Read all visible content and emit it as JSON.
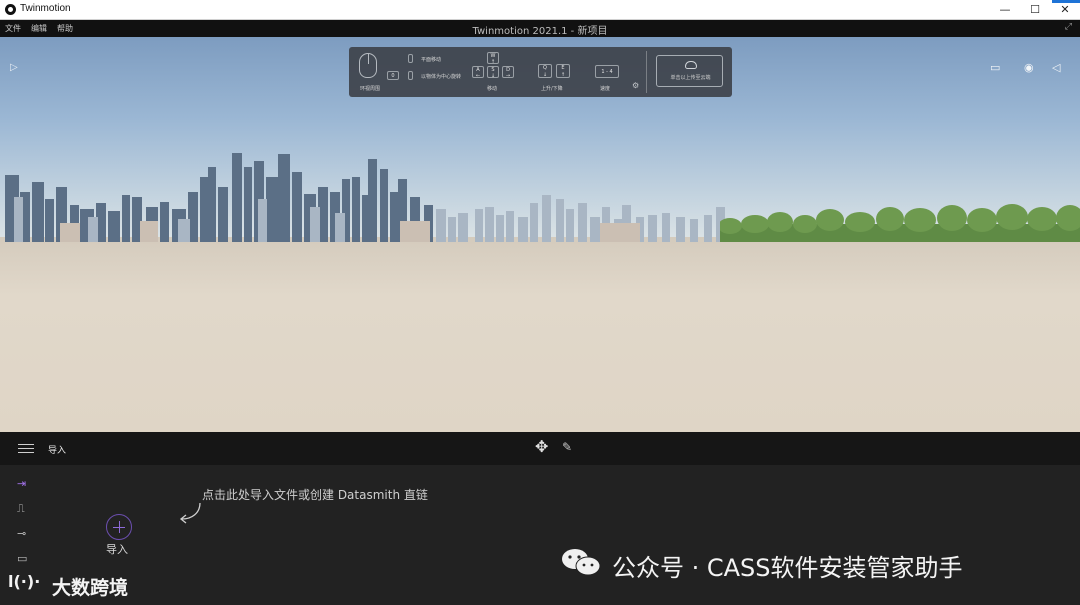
{
  "window": {
    "app_name": "Twinmotion",
    "controls": {
      "minimize": "—",
      "maximize": "☐",
      "close": "✕"
    }
  },
  "menubar": {
    "items": [
      "文件",
      "编辑",
      "帮助"
    ],
    "document_title": "Twinmotion 2021.1 - 新项目",
    "expand_icon": "⤢"
  },
  "viewport": {
    "left_toggle_icon": "▷",
    "right_tools": {
      "screen_icon": "▭",
      "eye_icon": "◉",
      "collapse_icon": "◁"
    }
  },
  "nav_help": {
    "pan_label": "平面移动",
    "orbit_label": "以物体为中心旋转",
    "look_label": "环视周围",
    "move_label": "移动",
    "updown_label": "上升/下降",
    "speed_label": "速度",
    "keys": {
      "w": "W",
      "a": "A",
      "s": "S",
      "d": "D",
      "q": "Q",
      "e": "E",
      "speed": "1 - 4",
      "mod": "0",
      "up_arrow": "↑",
      "left_arrow": "←",
      "down_arrow": "↓",
      "right_arrow": "→"
    },
    "upload_label": "单击以上传至云端",
    "gear_icon": "⚙"
  },
  "dock": {
    "section_title": "导入",
    "hint": "点击此处导入文件或创建 Datasmith 直链",
    "import_label": "导入",
    "pen_icon": "✎",
    "move_icon": "✥",
    "side_icons": [
      "⇥",
      "⎍",
      "⊸",
      "▭"
    ]
  },
  "watermarks": {
    "left_logo": "l(·)·",
    "left_text": "大数跨境",
    "right_text": "公众号 · CASS软件安装管家助手"
  },
  "colors": {
    "accent_purple": "#8d6ad8",
    "dock_bg": "#222222",
    "header_bg": "#161616"
  }
}
